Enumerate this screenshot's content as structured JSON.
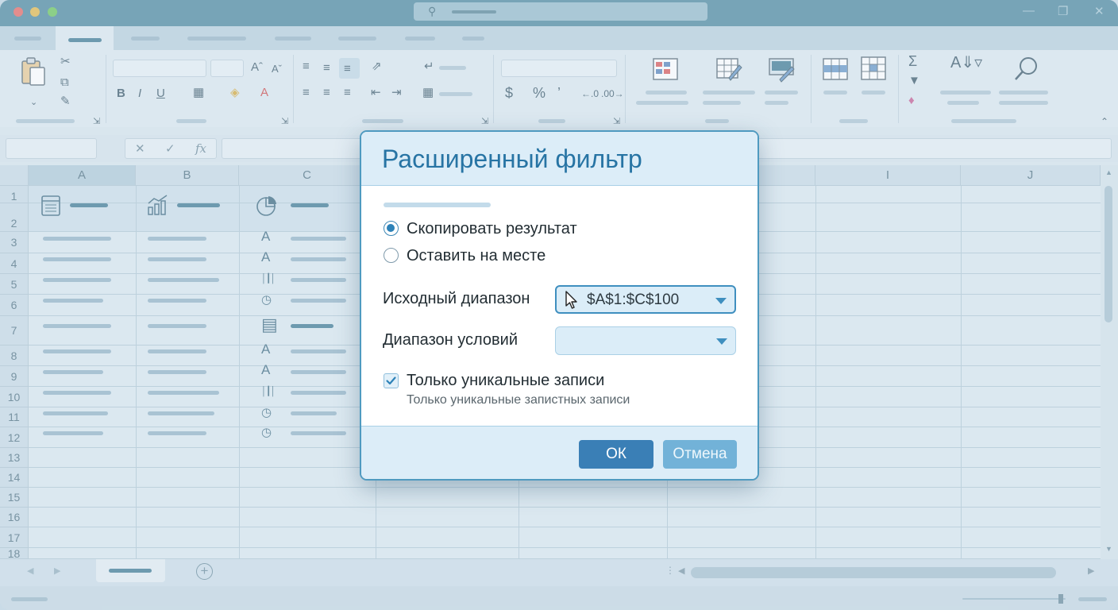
{
  "spreadsheet": {
    "columns": [
      "A",
      "B",
      "C",
      "I",
      "J"
    ],
    "rows": [
      "1",
      "2",
      "3",
      "4",
      "5",
      "6",
      "7",
      "8",
      "9",
      "10",
      "11",
      "12",
      "13",
      "14",
      "15",
      "16",
      "17",
      "18"
    ],
    "fx_label": "fx",
    "icons": [
      "list-icon",
      "chart-icon",
      "pie-icon",
      "text-a-icon",
      "bar-icon",
      "clock-icon"
    ]
  },
  "dialog": {
    "title": "Расширенный фильтр",
    "option_copy": "Скопировать результат",
    "option_inplace": "Оставить на месте",
    "selected_option": "copy",
    "source_label": "Исходный диапазон",
    "source_value": "$A$1:$C$100",
    "criteria_label": "Диапазон условий",
    "criteria_value": "",
    "unique_label": "Только уникальные записи",
    "unique_sublabel": "Только уникальные запистных записи",
    "unique_checked": true,
    "ok_label": "ОК",
    "cancel_label": "Отмена"
  },
  "colors": {
    "accent": "#3a7fb6",
    "title_bar": "#3e7f97",
    "dialog_title": "#2774a4"
  }
}
